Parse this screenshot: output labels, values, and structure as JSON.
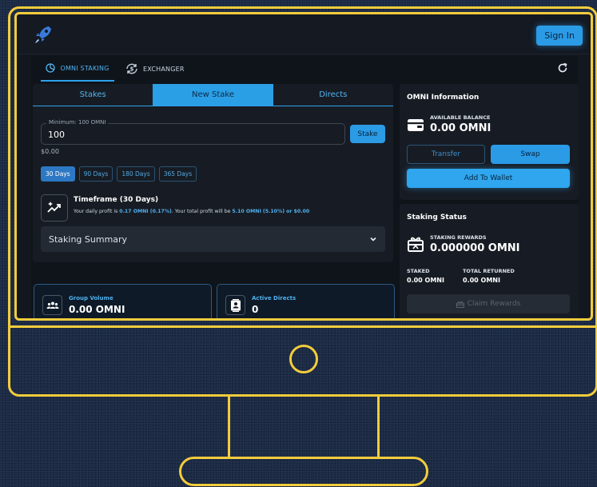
{
  "header": {
    "logo_icon": "rocket-logo-icon",
    "sign_in_label": "Sign In"
  },
  "top_tabs": {
    "staking_label": "OMNI STAKING",
    "exchanger_label": "EXCHANGER"
  },
  "stake_tabs": [
    {
      "label": "Stakes"
    },
    {
      "label": "New Stake"
    },
    {
      "label": "Directs"
    }
  ],
  "new_stake": {
    "input_label": "Minimum: 100 OMNI",
    "amount_value": "100",
    "stake_button_label": "Stake",
    "usd_value": "$0.00",
    "durations": [
      "30 Days",
      "90 Days",
      "180 Days",
      "365 Days"
    ],
    "selected_duration": "30 Days",
    "timeframe_title": "Timeframe (30 Days)",
    "profit_prefix": "Your daily profit is ",
    "daily_profit": "0.17 OMNI (0.17%)",
    "profit_middle": ". Your total profit will be ",
    "total_profit": "5.10 OMNI (5.10%) or $0.00",
    "summary_label": "Staking Summary"
  },
  "group_volume": {
    "label": "Group Volume",
    "value": "0.00 OMNI"
  },
  "active_directs": {
    "label": "Active Directs",
    "value": "0"
  },
  "omni_info": {
    "title": "OMNI Information",
    "available_balance_label": "AVAILABLE BALANCE",
    "available_balance_value": "0.00 OMNI",
    "transfer_label": "Transfer",
    "swap_label": "Swap",
    "add_to_wallet_label": "Add To Wallet"
  },
  "staking_status": {
    "title": "Staking Status",
    "rewards_label": "STAKING REWARDS",
    "rewards_value": "0.000000 OMNI",
    "staked_label": "STAKED",
    "staked_value": "0.00 OMNI",
    "total_returned_label": "TOTAL RETURNED",
    "total_returned_value": "0.00 OMNI",
    "claim_label": "Claim Rewards"
  },
  "colors": {
    "accent": "#2b9be6",
    "frame_outline": "#f2cc3c",
    "highlight_text": "#4fb0ee"
  }
}
